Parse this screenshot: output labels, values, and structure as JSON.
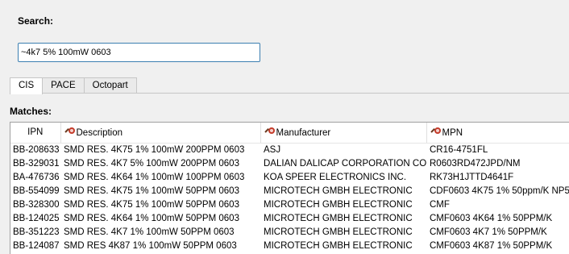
{
  "search": {
    "label": "Search:",
    "value": "~4k7 5% 100mW 0603"
  },
  "tabs": [
    {
      "label": "CIS",
      "active": true
    },
    {
      "label": "PACE",
      "active": false
    },
    {
      "label": "Octopart",
      "active": false
    }
  ],
  "matches": {
    "label": "Matches:",
    "columns": [
      "IPN",
      "Description",
      "Manufacturer",
      "MPN"
    ],
    "rows": [
      [
        "BB-208633",
        "SMD RES. 4K75 1% 100mW 200PPM 0603",
        "ASJ",
        "CR16-4751FL"
      ],
      [
        "BB-329031",
        "SMD RES. 4K7 5% 100mW 200PPM 0603",
        "DALIAN DALICAP CORPORATION CO.",
        "R0603RD472JPD/NM"
      ],
      [
        "BA-476736",
        "SMD RES. 4K64 1% 100mW 100PPM 0603",
        "KOA SPEER ELECTRONICS INC.",
        "RK73H1JTTD4641F"
      ],
      [
        "BB-554099",
        "SMD RES. 4K75 1% 100mW 50PPM 0603",
        "MICROTECH GMBH ELECTRONIC",
        "CDF0603 4K75 1% 50ppm/K NP5"
      ],
      [
        "BB-328300",
        "SMD RES. 4K75 1% 100mW 50PPM 0603",
        "MICROTECH GMBH ELECTRONIC",
        "CMF"
      ],
      [
        "BB-124025",
        "SMD RES. 4K64 1% 100mW 50PPM 0603",
        "MICROTECH GMBH ELECTRONIC",
        "CMF0603 4K64 1% 50PPM/K"
      ],
      [
        "BB-351223",
        "SMD RES. 4K7 1% 100mW 50PPM 0603",
        "MICROTECH GMBH ELECTRONIC",
        "CMF0603 4K7 1% 50PPM/K"
      ],
      [
        "BB-124087",
        "SMD RES 4K87 1% 100mW 50PPM 0603",
        "MICROTECH GMBH ELECTRONIC",
        "CMF0603 4K87 1% 50PPM/K"
      ]
    ]
  },
  "colors": {
    "input_border": "#3c7fb1",
    "search_icon": "#c43b2a"
  }
}
